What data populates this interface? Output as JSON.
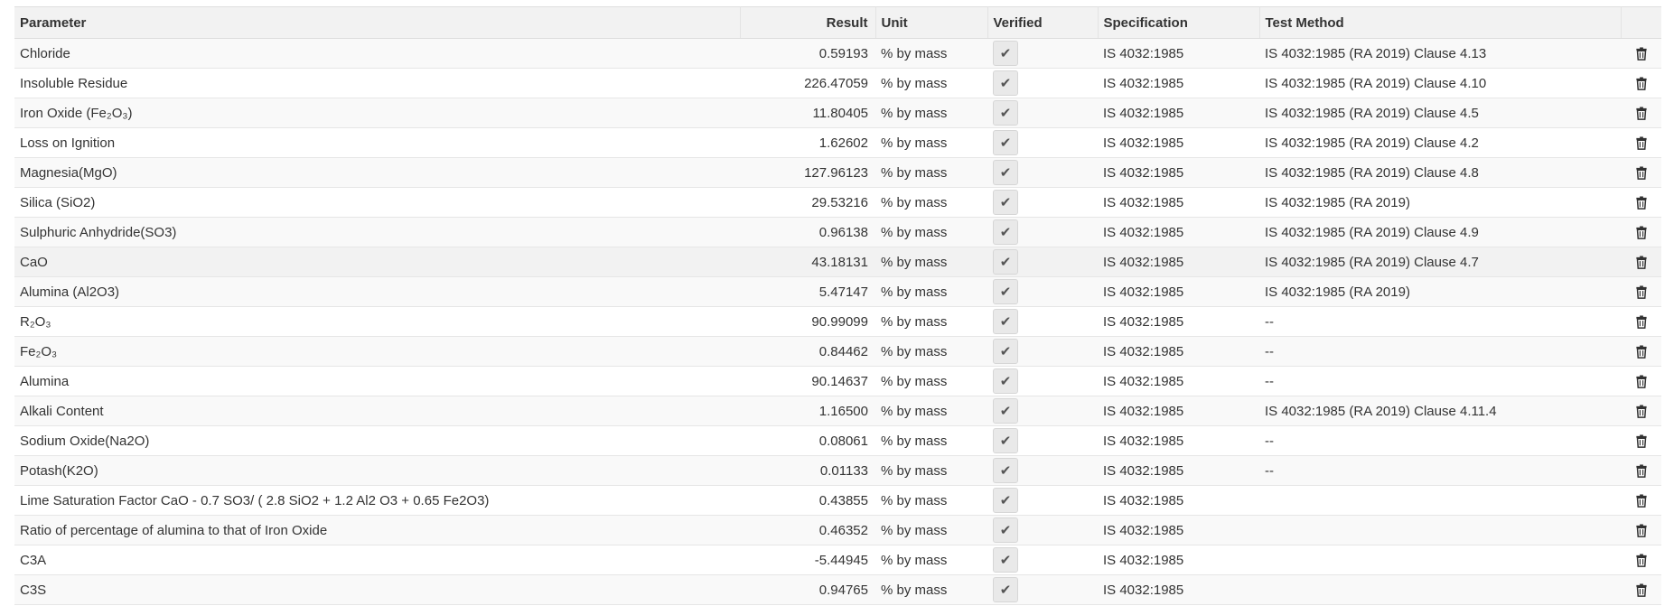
{
  "table": {
    "headers": {
      "parameter": "Parameter",
      "result": "Result",
      "unit": "Unit",
      "verified": "Verified",
      "specification": "Specification",
      "test_method": "Test Method"
    },
    "rows": [
      {
        "parameter": "Chloride",
        "result": "0.59193",
        "unit": "% by mass",
        "verified": true,
        "specification": "IS 4032:1985",
        "test_method": "IS 4032:1985 (RA 2019) Clause 4.13"
      },
      {
        "parameter": "Insoluble Residue",
        "result": "226.47059",
        "unit": "% by mass",
        "verified": true,
        "specification": "IS 4032:1985",
        "test_method": "IS 4032:1985 (RA 2019) Clause 4.10"
      },
      {
        "parameter": "Iron Oxide (Fe₂O₃)",
        "result": "11.80405",
        "unit": "% by mass",
        "verified": true,
        "specification": "IS 4032:1985",
        "test_method": "IS 4032:1985 (RA 2019) Clause 4.5"
      },
      {
        "parameter": "Loss on Ignition",
        "result": "1.62602",
        "unit": "% by mass",
        "verified": true,
        "specification": "IS 4032:1985",
        "test_method": "IS 4032:1985 (RA 2019) Clause 4.2"
      },
      {
        "parameter": "Magnesia(MgO)",
        "result": "127.96123",
        "unit": "% by mass",
        "verified": true,
        "specification": "IS 4032:1985",
        "test_method": "IS 4032:1985 (RA 2019) Clause 4.8"
      },
      {
        "parameter": "Silica (SiO2)",
        "result": "29.53216",
        "unit": "% by mass",
        "verified": true,
        "specification": "IS 4032:1985",
        "test_method": "IS 4032:1985 (RA 2019)"
      },
      {
        "parameter": "Sulphuric Anhydride(SO3)",
        "result": "0.96138",
        "unit": "% by mass",
        "verified": true,
        "specification": "IS 4032:1985",
        "test_method": "IS 4032:1985 (RA 2019) Clause 4.9"
      },
      {
        "parameter": "CaO",
        "result": "43.18131",
        "unit": "% by mass",
        "verified": true,
        "specification": "IS 4032:1985",
        "test_method": "IS 4032:1985 (RA 2019) Clause 4.7",
        "highlighted": true
      },
      {
        "parameter": "Alumina (Al2O3)",
        "result": "5.47147",
        "unit": "% by mass",
        "verified": true,
        "specification": "IS 4032:1985",
        "test_method": "IS 4032:1985 (RA 2019)"
      },
      {
        "parameter": "R₂O₃",
        "result": "90.99099",
        "unit": "% by mass",
        "verified": true,
        "specification": "IS 4032:1985",
        "test_method": "--"
      },
      {
        "parameter": "Fe₂O₃",
        "result": "0.84462",
        "unit": "% by mass",
        "verified": true,
        "specification": "IS 4032:1985",
        "test_method": "--"
      },
      {
        "parameter": "Alumina",
        "result": "90.14637",
        "unit": "% by mass",
        "verified": true,
        "specification": "IS 4032:1985",
        "test_method": "--"
      },
      {
        "parameter": "Alkali Content",
        "result": "1.16500",
        "unit": "% by mass",
        "verified": true,
        "specification": "IS 4032:1985",
        "test_method": "IS 4032:1985 (RA 2019) Clause 4.11.4"
      },
      {
        "parameter": "Sodium Oxide(Na2O)",
        "result": "0.08061",
        "unit": "% by mass",
        "verified": true,
        "specification": "IS 4032:1985",
        "test_method": "--"
      },
      {
        "parameter": "Potash(K2O)",
        "result": "0.01133",
        "unit": "% by mass",
        "verified": true,
        "specification": "IS 4032:1985",
        "test_method": "--"
      },
      {
        "parameter": "Lime Saturation Factor CaO - 0.7 SO3/ ( 2.8 SiO2 + 1.2 Al2 O3 + 0.65 Fe2O3)",
        "result": "0.43855",
        "unit": "% by mass",
        "verified": true,
        "specification": "IS 4032:1985",
        "test_method": ""
      },
      {
        "parameter": "Ratio of percentage of alumina to that of Iron Oxide",
        "result": "0.46352",
        "unit": "% by mass",
        "verified": true,
        "specification": "IS 4032:1985",
        "test_method": ""
      },
      {
        "parameter": "C3A",
        "result": "-5.44945",
        "unit": "% by mass",
        "verified": true,
        "specification": "IS 4032:1985",
        "test_method": ""
      },
      {
        "parameter": "C3S",
        "result": "0.94765",
        "unit": "% by mass",
        "verified": true,
        "specification": "IS 4032:1985",
        "test_method": ""
      }
    ],
    "icons": {
      "verified": "check-icon",
      "delete": "trash-icon"
    },
    "colors": {
      "header_bg": "#f2f2f2",
      "stripe_bg": "#f9f9f9",
      "checkbox_bg": "#e9e9e9"
    }
  }
}
